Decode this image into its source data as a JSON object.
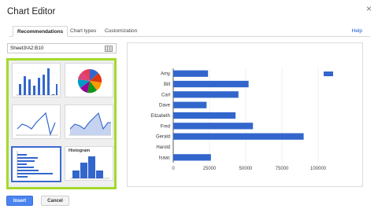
{
  "dialog": {
    "title": "Chart Editor",
    "close_glyph": "×"
  },
  "tabs": [
    {
      "label": "Recommendations",
      "active": true
    },
    {
      "label": "Chart types",
      "active": false
    },
    {
      "label": "Customization",
      "active": false
    }
  ],
  "help_label": "Help",
  "data_range": {
    "value": "Sheet3!A2:B10",
    "icon": "grid-icon"
  },
  "thumbnails": [
    {
      "kind": "column-chart",
      "selected": false
    },
    {
      "kind": "pie-chart",
      "selected": false
    },
    {
      "kind": "line-chart",
      "selected": false
    },
    {
      "kind": "area-chart",
      "selected": false
    },
    {
      "kind": "bar-chart",
      "selected": true
    },
    {
      "kind": "histogram-chart",
      "selected": false,
      "title": "Histogram"
    }
  ],
  "buttons": {
    "insert": "Insert",
    "cancel": "Cancel"
  },
  "colors": {
    "accent": "#3366cc",
    "highlight": "#a4d92a",
    "link": "#1155cc"
  },
  "chart_data": {
    "type": "bar",
    "orientation": "horizontal",
    "categories": [
      "Amy",
      "Bill",
      "Carl",
      "Dave",
      "Elizabeth",
      "Fred",
      "Gerald",
      "Harold",
      "Isaac"
    ],
    "values": [
      24000,
      52000,
      45000,
      23000,
      43000,
      55000,
      90000,
      0,
      26000
    ],
    "xlim": [
      0,
      125000
    ],
    "xticks": [
      0,
      25000,
      50000,
      75000,
      100000
    ],
    "xtick_labels": [
      "0",
      "25000",
      "50000",
      "75000",
      "100000"
    ],
    "grid": true,
    "legend": "right"
  }
}
